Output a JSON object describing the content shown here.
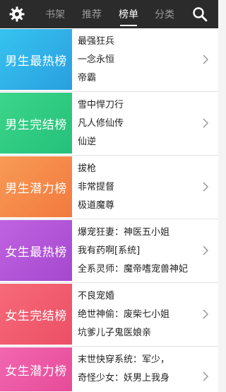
{
  "colors": {
    "topbar": "#2b2b2b",
    "banner_male_hot": "#32b9e8",
    "banner_male_complete": "#2ecc85",
    "banner_male_potential": "#f58a4a",
    "banner_female_hot": "#b456d8",
    "banner_female_complete": "#f15d70",
    "banner_female_potential": "#ee5aa6"
  },
  "header": {
    "settings_icon": "gear-icon",
    "search_icon": "search-icon",
    "tabs": [
      {
        "label": "书架",
        "active": false
      },
      {
        "label": "推荐",
        "active": false
      },
      {
        "label": "榜单",
        "active": true
      },
      {
        "label": "分类",
        "active": false
      }
    ]
  },
  "rankings": [
    {
      "title": "男生最热榜",
      "books": [
        "最强狂兵",
        "一念永恒",
        "帝霸"
      ]
    },
    {
      "title": "男生完结榜",
      "books": [
        "雪中悍刀行",
        "凡人修仙传",
        "仙逆"
      ]
    },
    {
      "title": "男生潜力榜",
      "books": [
        "拔枪",
        "非常提督",
        "极道魔尊"
      ]
    },
    {
      "title": "女生最热榜",
      "books": [
        "爆宠狂妻：神医五小姐",
        "我有药啊[系统]",
        "全系灵师：魔帝嗜宠兽神妃"
      ]
    },
    {
      "title": "女生完结榜",
      "books": [
        "不良宠婚",
        "绝世神偷：废柴七小姐",
        "坑爹儿子鬼医娘亲"
      ]
    },
    {
      "title": "女生潜力榜",
      "books": [
        "末世快穿系统：军少，",
        "奇怪少女：妖男上我身"
      ]
    }
  ]
}
